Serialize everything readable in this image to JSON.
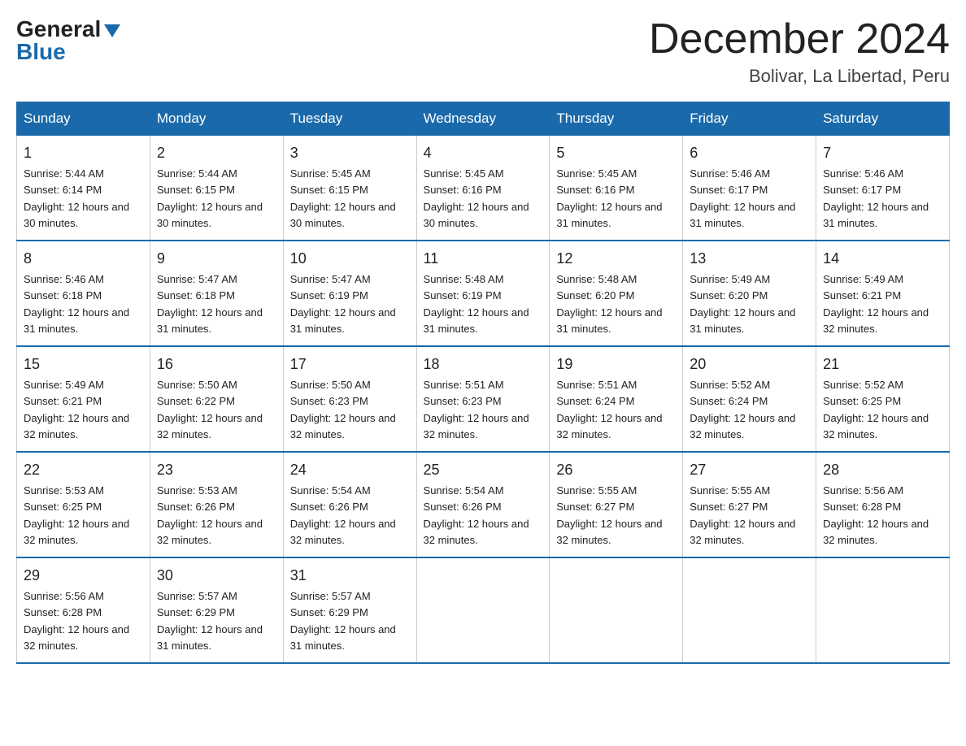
{
  "header": {
    "logo_general": "General",
    "logo_blue": "Blue",
    "month_title": "December 2024",
    "location": "Bolivar, La Libertad, Peru"
  },
  "days_of_week": [
    "Sunday",
    "Monday",
    "Tuesday",
    "Wednesday",
    "Thursday",
    "Friday",
    "Saturday"
  ],
  "weeks": [
    [
      {
        "day": "1",
        "sunrise": "5:44 AM",
        "sunset": "6:14 PM",
        "daylight": "12 hours and 30 minutes."
      },
      {
        "day": "2",
        "sunrise": "5:44 AM",
        "sunset": "6:15 PM",
        "daylight": "12 hours and 30 minutes."
      },
      {
        "day": "3",
        "sunrise": "5:45 AM",
        "sunset": "6:15 PM",
        "daylight": "12 hours and 30 minutes."
      },
      {
        "day": "4",
        "sunrise": "5:45 AM",
        "sunset": "6:16 PM",
        "daylight": "12 hours and 30 minutes."
      },
      {
        "day": "5",
        "sunrise": "5:45 AM",
        "sunset": "6:16 PM",
        "daylight": "12 hours and 31 minutes."
      },
      {
        "day": "6",
        "sunrise": "5:46 AM",
        "sunset": "6:17 PM",
        "daylight": "12 hours and 31 minutes."
      },
      {
        "day": "7",
        "sunrise": "5:46 AM",
        "sunset": "6:17 PM",
        "daylight": "12 hours and 31 minutes."
      }
    ],
    [
      {
        "day": "8",
        "sunrise": "5:46 AM",
        "sunset": "6:18 PM",
        "daylight": "12 hours and 31 minutes."
      },
      {
        "day": "9",
        "sunrise": "5:47 AM",
        "sunset": "6:18 PM",
        "daylight": "12 hours and 31 minutes."
      },
      {
        "day": "10",
        "sunrise": "5:47 AM",
        "sunset": "6:19 PM",
        "daylight": "12 hours and 31 minutes."
      },
      {
        "day": "11",
        "sunrise": "5:48 AM",
        "sunset": "6:19 PM",
        "daylight": "12 hours and 31 minutes."
      },
      {
        "day": "12",
        "sunrise": "5:48 AM",
        "sunset": "6:20 PM",
        "daylight": "12 hours and 31 minutes."
      },
      {
        "day": "13",
        "sunrise": "5:49 AM",
        "sunset": "6:20 PM",
        "daylight": "12 hours and 31 minutes."
      },
      {
        "day": "14",
        "sunrise": "5:49 AM",
        "sunset": "6:21 PM",
        "daylight": "12 hours and 32 minutes."
      }
    ],
    [
      {
        "day": "15",
        "sunrise": "5:49 AM",
        "sunset": "6:21 PM",
        "daylight": "12 hours and 32 minutes."
      },
      {
        "day": "16",
        "sunrise": "5:50 AM",
        "sunset": "6:22 PM",
        "daylight": "12 hours and 32 minutes."
      },
      {
        "day": "17",
        "sunrise": "5:50 AM",
        "sunset": "6:23 PM",
        "daylight": "12 hours and 32 minutes."
      },
      {
        "day": "18",
        "sunrise": "5:51 AM",
        "sunset": "6:23 PM",
        "daylight": "12 hours and 32 minutes."
      },
      {
        "day": "19",
        "sunrise": "5:51 AM",
        "sunset": "6:24 PM",
        "daylight": "12 hours and 32 minutes."
      },
      {
        "day": "20",
        "sunrise": "5:52 AM",
        "sunset": "6:24 PM",
        "daylight": "12 hours and 32 minutes."
      },
      {
        "day": "21",
        "sunrise": "5:52 AM",
        "sunset": "6:25 PM",
        "daylight": "12 hours and 32 minutes."
      }
    ],
    [
      {
        "day": "22",
        "sunrise": "5:53 AM",
        "sunset": "6:25 PM",
        "daylight": "12 hours and 32 minutes."
      },
      {
        "day": "23",
        "sunrise": "5:53 AM",
        "sunset": "6:26 PM",
        "daylight": "12 hours and 32 minutes."
      },
      {
        "day": "24",
        "sunrise": "5:54 AM",
        "sunset": "6:26 PM",
        "daylight": "12 hours and 32 minutes."
      },
      {
        "day": "25",
        "sunrise": "5:54 AM",
        "sunset": "6:26 PM",
        "daylight": "12 hours and 32 minutes."
      },
      {
        "day": "26",
        "sunrise": "5:55 AM",
        "sunset": "6:27 PM",
        "daylight": "12 hours and 32 minutes."
      },
      {
        "day": "27",
        "sunrise": "5:55 AM",
        "sunset": "6:27 PM",
        "daylight": "12 hours and 32 minutes."
      },
      {
        "day": "28",
        "sunrise": "5:56 AM",
        "sunset": "6:28 PM",
        "daylight": "12 hours and 32 minutes."
      }
    ],
    [
      {
        "day": "29",
        "sunrise": "5:56 AM",
        "sunset": "6:28 PM",
        "daylight": "12 hours and 32 minutes."
      },
      {
        "day": "30",
        "sunrise": "5:57 AM",
        "sunset": "6:29 PM",
        "daylight": "12 hours and 31 minutes."
      },
      {
        "day": "31",
        "sunrise": "5:57 AM",
        "sunset": "6:29 PM",
        "daylight": "12 hours and 31 minutes."
      },
      null,
      null,
      null,
      null
    ]
  ]
}
